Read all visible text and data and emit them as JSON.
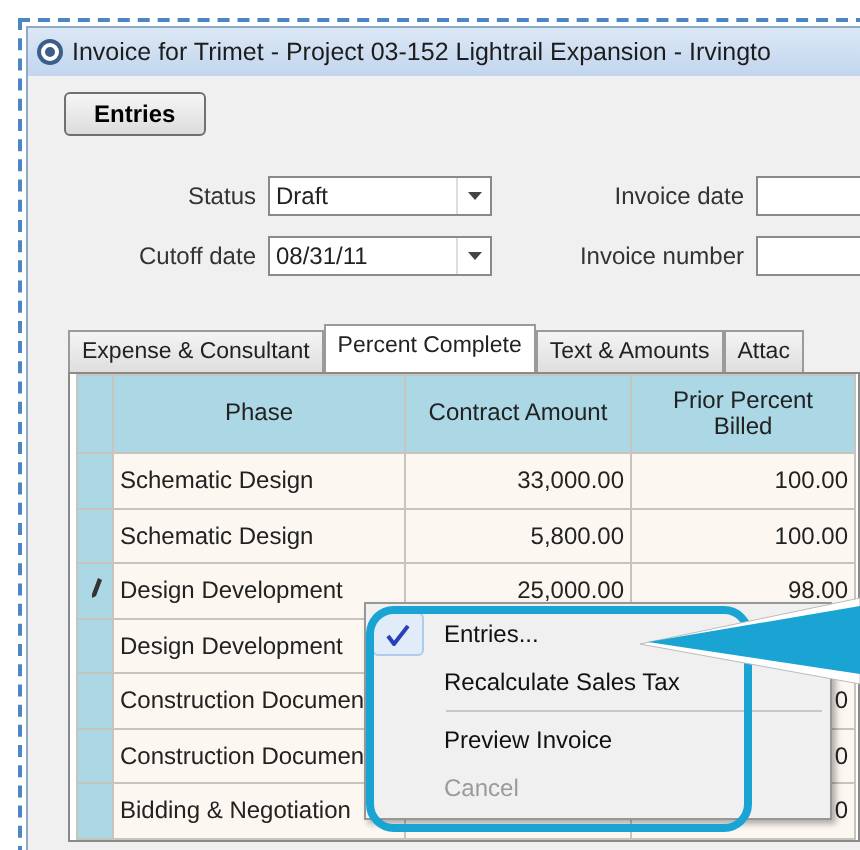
{
  "window": {
    "title": "Invoice for Trimet - Project 03-152 Lightrail Expansion - Irvingto"
  },
  "toolbar": {
    "entries_button": "Entries"
  },
  "form": {
    "fields": [
      {
        "label": "Status",
        "value": "Draft",
        "kind": "combo"
      },
      {
        "label": "Invoice date",
        "kind": "text"
      },
      {
        "label": "Cutoff date",
        "value": "08/31/11",
        "kind": "combo"
      },
      {
        "label": "Invoice number",
        "kind": "text"
      }
    ]
  },
  "tabs": [
    {
      "label": "Expense & Consultant",
      "selected": false
    },
    {
      "label": "Percent Complete",
      "selected": true
    },
    {
      "label": "Text & Amounts",
      "selected": false
    },
    {
      "label": "Attac",
      "selected": false
    }
  ],
  "table": {
    "columns": [
      "Phase",
      "Contract Amount",
      "Prior Percent Billed"
    ],
    "rows": [
      {
        "editing": false,
        "cells": [
          "Schematic Design",
          "33,000.00",
          "100.00"
        ]
      },
      {
        "editing": false,
        "cells": [
          "Schematic Design",
          "5,800.00",
          "100.00"
        ]
      },
      {
        "editing": true,
        "cells": [
          "Design Development",
          "25,000.00",
          "98.00"
        ]
      },
      {
        "editing": false,
        "cells": [
          "Design Development",
          "",
          ""
        ]
      },
      {
        "editing": false,
        "cells": [
          "Construction  Documen",
          "",
          "0"
        ]
      },
      {
        "editing": false,
        "cells": [
          "Construction  Documen",
          "",
          "0"
        ]
      },
      {
        "editing": false,
        "cells": [
          "Bidding & Negotiation",
          "",
          "0"
        ]
      }
    ]
  },
  "context_menu": {
    "items": [
      {
        "label": "Entries...",
        "checked": true,
        "disabled": false,
        "separator_before": false
      },
      {
        "label": "Recalculate Sales Tax",
        "checked": false,
        "disabled": false,
        "separator_before": false
      },
      {
        "label": "Preview Invoice",
        "checked": false,
        "disabled": false,
        "separator_before": true
      },
      {
        "label": "Cancel",
        "checked": false,
        "disabled": true,
        "separator_before": false
      }
    ]
  }
}
